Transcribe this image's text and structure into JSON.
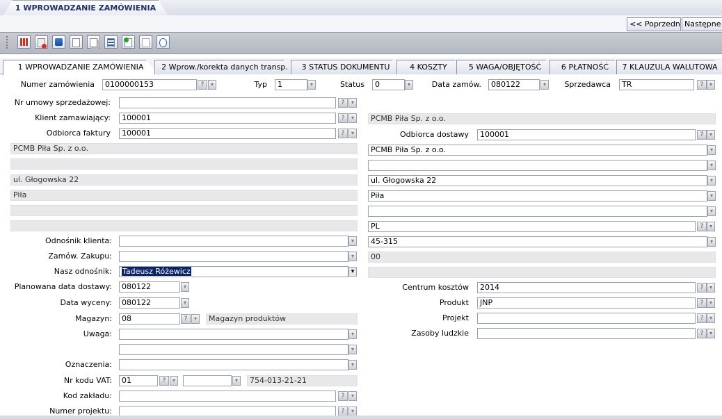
{
  "window": {
    "main_tab": "1 WPROWADZANIE ZAMÓWIENIA"
  },
  "nav": {
    "prev": "<< Poprzedni",
    "next": "Następne >"
  },
  "tabs": [
    "1 WPROWADZANIE ZAMÓWIENIA",
    "2 Wprow./korekta danych transp.",
    "3 STATUS DOKUMENTU",
    "4 KOSZTY",
    "5 WAGA/OBJĘTOŚĆ",
    "6 PŁATNOŚĆ",
    "7 KLAUZULA WALUTOWA"
  ],
  "header": {
    "order_number_label": "Numer zamówienia",
    "order_number": "0100000153",
    "type_label": "Typ",
    "type": "1",
    "status_label": "Status",
    "status": "0",
    "order_date_label": "Data zamów.",
    "order_date": "080122",
    "seller_label": "Sprzedawca",
    "seller": "TR"
  },
  "left": {
    "contract_label": "Nr umowy sprzedażowej:",
    "contract": "",
    "client_label": "Klient zamawiający:",
    "client": "100001",
    "invoice_label": "Odbiorca faktury",
    "invoice": "100001",
    "addr1": "PCMB Piła Sp. z o.o.",
    "addr2": "",
    "addr3": "ul. Głogowska 22",
    "addr4": "Piła",
    "addr5": "",
    "addr6": "",
    "client_ref_label": "Odnośnik klienta:",
    "client_ref": "",
    "purchase_label": "Zamów. Zakupu:",
    "purchase": "",
    "our_ref_label": "Nasz odnośnik:",
    "our_ref": "Tadeusz Różewicz",
    "planned_date_label": "Planowana data dostawy:",
    "planned_date": "080122",
    "quote_date_label": "Data wyceny:",
    "quote_date": "080122",
    "warehouse_label": "Magazyn:",
    "warehouse": "08",
    "warehouse_name": "Magazyn produktów",
    "notes_label": "Uwaga:",
    "notes1": "",
    "notes2": "",
    "marks_label": "Oznaczenia:",
    "marks": "",
    "vat_label": "Nr kodu VAT:",
    "vat_code": "01",
    "vat_extra": "",
    "vat_number": "754-013-21-21",
    "plant_label": "Kod zakładu:",
    "plant": "",
    "project_no_label": "Numer projektu:",
    "project_no": ""
  },
  "right": {
    "client_name": "PCMB Piła Sp. z o.o.",
    "delivery_label": "Odbiorca dostawy",
    "delivery": "100001",
    "addr1": "PCMB Piła Sp. z o.o.",
    "addr2": "",
    "addr3": "ul. Głogowska 22",
    "addr4": "Piła",
    "addr5": "",
    "country": "PL",
    "postcode": "45-315",
    "purchase_ro": "00",
    "our_ref_ro": "",
    "cost_center_label": "Centrum kosztów",
    "cost_center": "2014",
    "product_label": "Produkt",
    "product": "JNP",
    "project_label": "Projekt",
    "project": "",
    "hr_label": "Zasoby ludzkie",
    "hr": ""
  },
  "icons": {
    "question": "?",
    "dropdown": "▾"
  },
  "colors": {
    "selection": "#0a246a",
    "readonly": "#e8e8ea"
  }
}
